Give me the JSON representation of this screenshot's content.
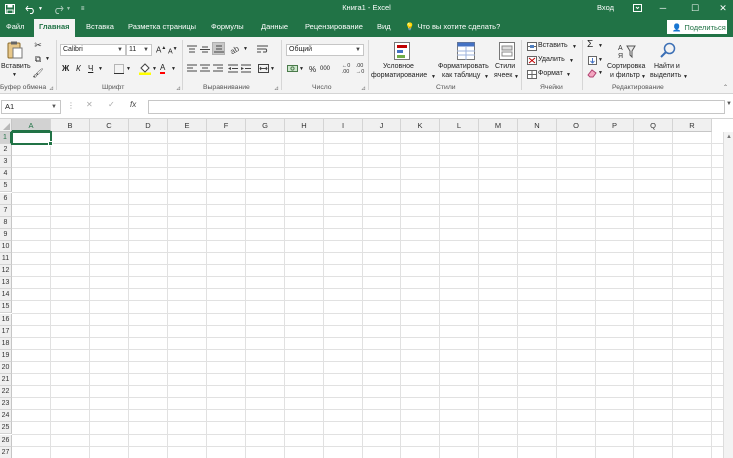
{
  "titlebar": {
    "title": "Книга1  -  Excel",
    "signin": "Вход",
    "icons": {
      "save": "save-icon",
      "undo": "undo-icon",
      "redo": "redo-icon",
      "customize": "customize-qat-icon"
    }
  },
  "tabs": [
    "Файл",
    "Главная",
    "Вставка",
    "Разметка страницы",
    "Формулы",
    "Данные",
    "Рецензирование",
    "Вид"
  ],
  "active_tab": "Главная",
  "tell_me": "Что вы хотите сделать?",
  "share": "Поделиться",
  "ribbon": {
    "clipboard": {
      "paste": "Вставить",
      "label": "Буфер обмена"
    },
    "font": {
      "name": "Calibri",
      "size": "11",
      "bold": "Ж",
      "italic": "К",
      "underline": "Ч",
      "grow": "A",
      "shrink": "A",
      "color_letter": "A",
      "label": "Шрифт"
    },
    "alignment": {
      "label": "Выравнивание"
    },
    "number": {
      "format": "Общий",
      "percent": "%",
      "comma": "000",
      "label": "Число"
    },
    "styles": {
      "conditional_line1": "Условное",
      "conditional_line2": "форматирование",
      "table_line1": "Форматировать",
      "table_line2": "как таблицу",
      "cell_line1": "Стили",
      "cell_line2": "ячеек",
      "label": "Стили"
    },
    "cells": {
      "insert": "Вставить",
      "delete": "Удалить",
      "format": "Формат",
      "label": "Ячейки"
    },
    "editing": {
      "sort_line1": "Сортировка",
      "sort_line2": "и фильтр",
      "find_line1": "Найти и",
      "find_line2": "выделить",
      "label": "Редактирование"
    }
  },
  "formula_bar": {
    "name_box": "A1",
    "fx": "fx",
    "value": ""
  },
  "columns": [
    "A",
    "B",
    "C",
    "D",
    "E",
    "F",
    "G",
    "H",
    "I",
    "J",
    "K",
    "L",
    "M",
    "N",
    "O",
    "P",
    "Q",
    "R"
  ],
  "rows": [
    "1",
    "2",
    "3",
    "4",
    "5",
    "6",
    "7",
    "8",
    "9",
    "10",
    "11",
    "12",
    "13",
    "14",
    "15",
    "16",
    "17",
    "18",
    "19",
    "20",
    "21",
    "22",
    "23",
    "24",
    "25",
    "26",
    "27"
  ],
  "selected_cell": "A1",
  "colors": {
    "accent": "#217346",
    "ribbon_bg": "#f3f3f3",
    "fill": "#ffff00",
    "font_red": "#ff0000"
  }
}
